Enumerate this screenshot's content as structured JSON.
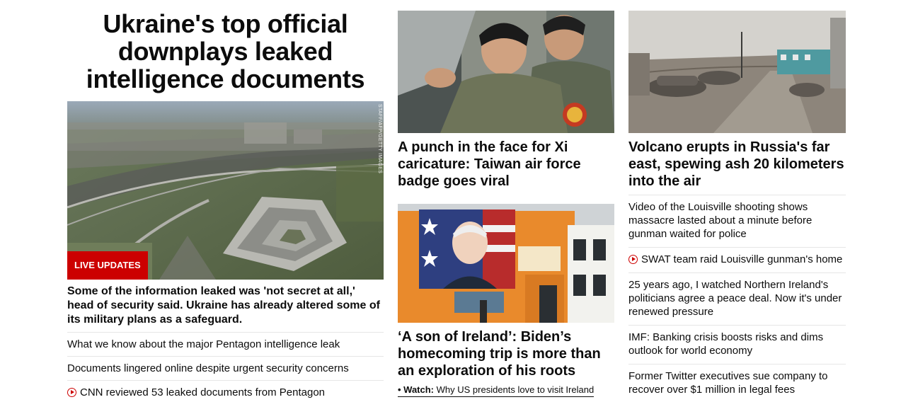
{
  "lead": {
    "title": "Ukraine's top official downplays leaked intelligence documents",
    "image_credit": "STAFF/AFP/GETTY IMAGES",
    "badge": "LIVE UPDATES",
    "summary": "Some of the information leaked was 'not secret at all,' head of security said. Ukraine has already altered some of its military plans as a safeguard.",
    "links": [
      {
        "text": "What we know about the major Pentagon intelligence leak",
        "video": false
      },
      {
        "text": "Documents lingered online despite urgent security concerns",
        "video": false
      },
      {
        "text": "CNN reviewed 53 leaked documents from Pentagon",
        "video": true
      }
    ]
  },
  "middle": {
    "story1_title": "A punch in the face for Xi caricature: Taiwan air force badge goes viral",
    "story2_title": "‘A son of Ireland’: Biden’s homecoming trip is more than an exploration of his roots",
    "watch_label": "• Watch:",
    "watch_text": "Why US presidents love to visit Ireland"
  },
  "right": {
    "story_title": "Volcano erupts in Russia's far east, spewing ash 20 kilometers into the air",
    "links": [
      {
        "text": "Video of the Louisville shooting shows massacre lasted about a minute before gunman waited for police",
        "video": false
      },
      {
        "text": "SWAT team raid Louisville gunman's home",
        "video": true
      },
      {
        "text": "25 years ago, I watched Northern Ireland's politicians agree a peace deal. Now it's under renewed pressure",
        "video": false
      },
      {
        "text": "IMF: Banking crisis boosts risks and dims outlook for world economy",
        "video": false
      },
      {
        "text": "Former Twitter executives sue company to recover over $1 million in legal fees",
        "video": false
      }
    ]
  },
  "colors": {
    "accent": "#cc0000",
    "text": "#0c0c0c",
    "divider": "#e6e6e6"
  },
  "icons": {
    "video": "play-circle-icon"
  }
}
